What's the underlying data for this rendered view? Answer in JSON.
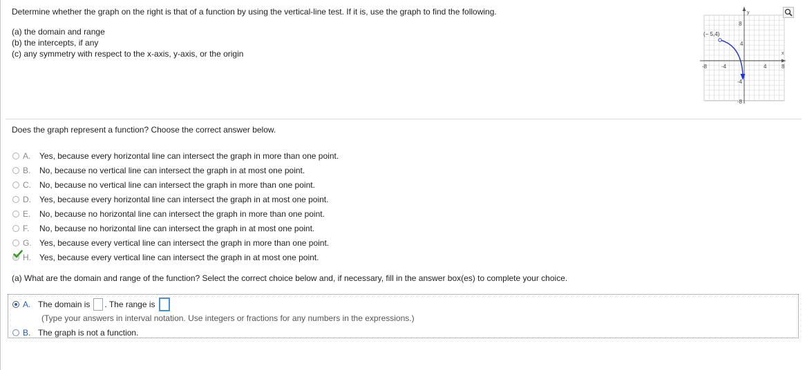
{
  "instructions": {
    "line1": "Determine whether the graph on the right is that of a function by using the vertical-line test. If it is, use the graph to find the following.",
    "a": "(a) the domain and range",
    "b": "(b) the intercepts, if any",
    "c": "(c) any symmetry with respect to the x-axis, y-axis, or the origin"
  },
  "graph": {
    "point_label": "(− 5,4)",
    "x_axis_label": "x",
    "y_axis_label": "y",
    "x_ticks": [
      "-8",
      "-4",
      "4",
      "8"
    ],
    "y_ticks": [
      "8",
      "4",
      "-4",
      "-8"
    ],
    "curve_color": "#2c3fb8",
    "endpoint_color": "#1a35e0"
  },
  "question1": {
    "prompt": "Does the graph represent a function? Choose the correct answer below.",
    "selected": "H",
    "choices": [
      {
        "letter": "A.",
        "text": "Yes, because every horizontal line can intersect the graph in more than one point."
      },
      {
        "letter": "B.",
        "text": "No, because no vertical line can intersect the graph in at most one point."
      },
      {
        "letter": "C.",
        "text": "No, because no vertical line can intersect the graph in more than one point."
      },
      {
        "letter": "D.",
        "text": "Yes, because every horizontal line can intersect the graph in at most one point."
      },
      {
        "letter": "E.",
        "text": "No, because no horizontal line can intersect the graph in more than one point."
      },
      {
        "letter": "F.",
        "text": "No, because no horizontal line can intersect the graph in at most one point."
      },
      {
        "letter": "G.",
        "text": "Yes, because every vertical line can intersect the graph in more than one point."
      },
      {
        "letter": "H.",
        "text": "Yes, because every vertical line can intersect the graph in at most one point."
      }
    ]
  },
  "question2": {
    "prompt": "(a) What are the domain and range of the function? Select the correct choice below and, if necessary, fill in the answer box(es) to complete your choice.",
    "a_letter": "A.",
    "a_domain_text": "The domain is",
    "a_range_text": ". The range is",
    "a_hint": "(Type your answers in interval notation. Use integers or fractions for any numbers in the expressions.)",
    "b_letter": "B.",
    "b_text": "The graph is not a function."
  },
  "colors": {
    "accent_blue": "#2a5db0",
    "check_green": "#3a9a2a"
  }
}
